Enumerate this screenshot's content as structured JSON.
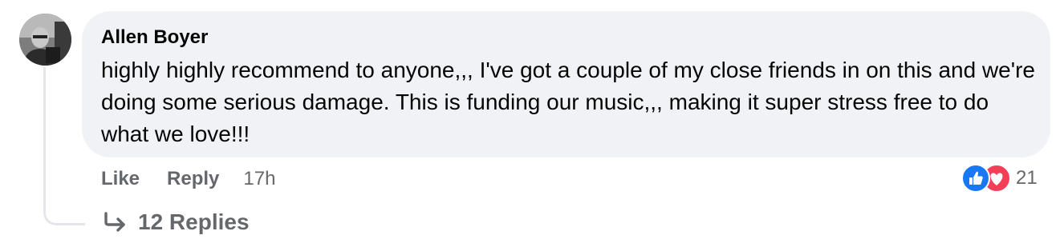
{
  "comment": {
    "author": "Allen Boyer",
    "text": "highly highly recommend to anyone,,, I've got a couple of my close friends in on this and we're doing some serious damage. This is funding our music,,, making it super stress free to do what we love!!!",
    "actions": {
      "like_label": "Like",
      "reply_label": "Reply",
      "timestamp": "17h"
    },
    "reactions": {
      "icons": [
        "like-icon",
        "heart-icon"
      ],
      "count": "21"
    },
    "replies_label": "12 Replies"
  },
  "colors": {
    "bubble": "#f0f2f5",
    "secondary_text": "#65676b",
    "like_blue": "#1877f2",
    "heart_red": "#f33e58"
  }
}
